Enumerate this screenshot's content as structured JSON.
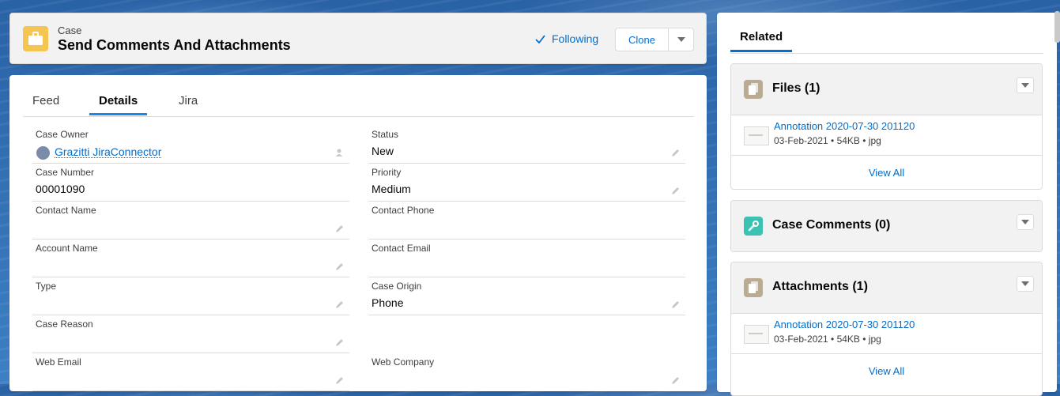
{
  "header": {
    "object_label": "Case",
    "title": "Send Comments And Attachments",
    "following_label": "Following",
    "clone_label": "Clone"
  },
  "tabs": [
    {
      "label": "Feed"
    },
    {
      "label": "Details"
    },
    {
      "label": "Jira"
    }
  ],
  "fields": {
    "case_owner": {
      "label": "Case Owner",
      "value": "Grazitti JiraConnector"
    },
    "status": {
      "label": "Status",
      "value": "New"
    },
    "case_number": {
      "label": "Case Number",
      "value": "00001090"
    },
    "priority": {
      "label": "Priority",
      "value": "Medium"
    },
    "contact_name": {
      "label": "Contact Name",
      "value": ""
    },
    "contact_phone": {
      "label": "Contact Phone",
      "value": ""
    },
    "account_name": {
      "label": "Account Name",
      "value": ""
    },
    "contact_email": {
      "label": "Contact Email",
      "value": ""
    },
    "type": {
      "label": "Type",
      "value": ""
    },
    "case_origin": {
      "label": "Case Origin",
      "value": "Phone"
    },
    "case_reason": {
      "label": "Case Reason",
      "value": ""
    },
    "web_email": {
      "label": "Web Email",
      "value": ""
    },
    "web_company": {
      "label": "Web Company",
      "value": ""
    }
  },
  "related": {
    "tab_label": "Related",
    "files": {
      "title": "Files (1)",
      "items": [
        {
          "name": "Annotation 2020-07-30 201120",
          "meta": "03-Feb-2021 • 54KB • jpg"
        }
      ],
      "view_all": "View All"
    },
    "case_comments": {
      "title": "Case Comments (0)"
    },
    "attachments": {
      "title": "Attachments (1)",
      "items": [
        {
          "name": "Annotation 2020-07-30 201120",
          "meta": "03-Feb-2021 • 54KB • jpg"
        }
      ],
      "view_all": "View All"
    }
  },
  "colors": {
    "brand": "#0070d2",
    "case_icon": "#f4c550",
    "files_icon": "#baac93",
    "comments_icon": "#3cc2b3"
  }
}
